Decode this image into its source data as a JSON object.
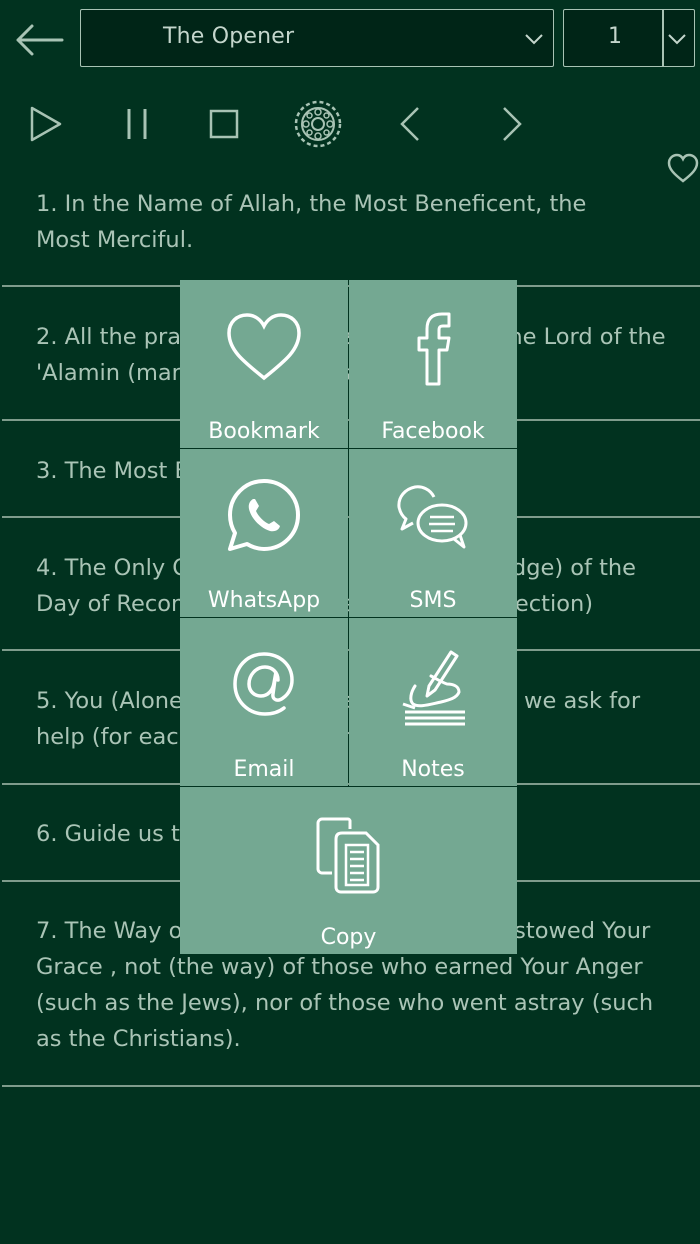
{
  "header": {
    "chapter_select": "The Opener",
    "verse_select": "1"
  },
  "verses": [
    {
      "number": 1,
      "text": "1. In the Name of Allah, the Most Beneficent, the Most Merciful."
    },
    {
      "number": 2,
      "text": "2. All the praises and thanks be to Allah, the Lord of the 'Alamin (mankind, jinn and all that exists)."
    },
    {
      "number": 3,
      "text": "3. The Most Beneficent, the Most Merciful."
    },
    {
      "number": 4,
      "text": "4. The Only Owner (and the Only Ruling Judge) of the Day of Recompense (i.e. the Day of Resurrection)"
    },
    {
      "number": 5,
      "text": "5. You (Alone) we worship, and You (Alone) we ask for help (for each and everything)."
    },
    {
      "number": 6,
      "text": "6. Guide us to the Straight Way"
    },
    {
      "number": 7,
      "text": "7. The Way of those on whom You have bestowed Your Grace , not (the way) of those who earned Your Anger (such as the Jews), nor of those who went astray (such as the Christians)."
    }
  ],
  "share_menu": {
    "bookmark": "Bookmark",
    "facebook": "Facebook",
    "whatsapp": "WhatsApp",
    "sms": "SMS",
    "email": "Email",
    "notes": "Notes",
    "copy": "Copy"
  },
  "colors": {
    "background": "#01321f",
    "menu_tile": "#74a892",
    "text": "#aac4b6"
  }
}
